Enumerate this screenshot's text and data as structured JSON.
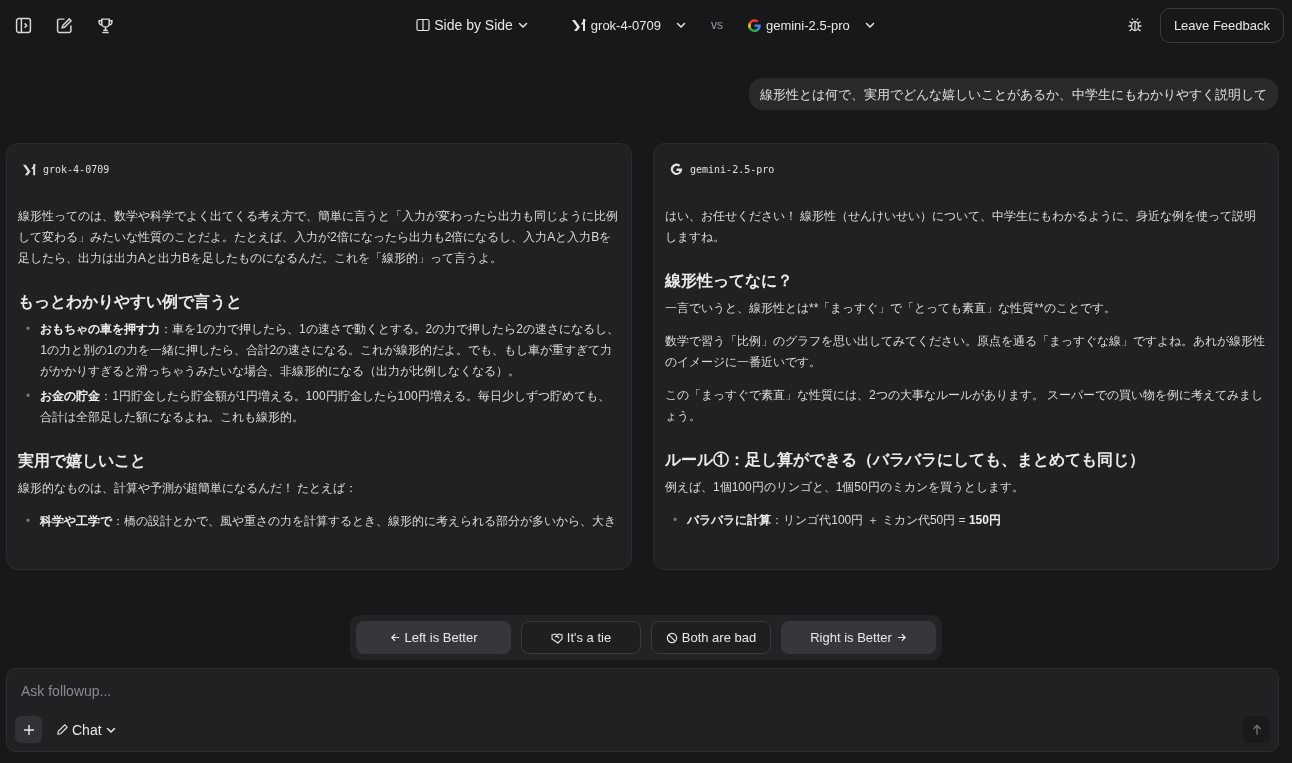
{
  "header": {
    "mode": "Side by Side",
    "model_a": "grok-4-0709",
    "vs": "vs",
    "model_b": "gemini-2.5-pro",
    "feedback": "Leave Feedback"
  },
  "prompt": "線形性とは何で、実用でどんな嬉しいことがあるか、中学生にもわかりやすく説明して",
  "panels": [
    {
      "model": "grok-4-0709",
      "blocks": [
        {
          "kind": "paragraph",
          "text": "線形性ってのは、数学や科学でよく出てくる考え方で、簡単に言うと「入力が変わったら出力も同じように比例して変わる」みたいな性質のことだよ。たとえば、入力が2倍になったら出力も2倍になるし、入力Aと入力Bを足したら、出力は出力Aと出力Bを足したものになるんだ。これを「線形的」って言うよ。"
        },
        {
          "kind": "heading",
          "text": "もっとわかりやすい例で言うと"
        },
        {
          "kind": "bullets",
          "items": [
            {
              "marker": "•",
              "text": "**おもちゃの車を押す力**：車を1の力で押したら、1の速さで動くとする。2の力で押したら2の速さになるし、1の力と別の1の力を一緒に押したら、合計2の速さになる。これが線形的だよ。でも、もし車が重すぎて力がかかりすぎると滑っちゃうみたいな場合、非線形的になる（出力が比例しなくなる）。"
            },
            {
              "marker": "•",
              "text": "**お金の貯金**：1円貯金したら貯金額が1円増える。100円貯金したら100円増える。毎日少しずつ貯めても、合計は全部足した額になるよね。これも線形的。"
            }
          ]
        },
        {
          "kind": "heading",
          "text": "実用で嬉しいこと"
        },
        {
          "kind": "paragraph",
          "text": "線形的なものは、計算や予測が超簡単になるんだ！ たとえば："
        },
        {
          "kind": "bullets",
          "items": [
            {
              "marker": "•",
              "text": "**科学や工学で**：橋の設計とかで、風や重さの力を計算するとき、線形的に考えられる部分が多いから、大き"
            }
          ]
        }
      ]
    },
    {
      "model": "gemini-2.5-pro",
      "blocks": [
        {
          "kind": "paragraph",
          "text": "はい、お任せください！ 線形性（せんけいせい）について、中学生にもわかるように、身近な例を使って説明しますね。"
        },
        {
          "kind": "heading",
          "text": "線形性ってなに？"
        },
        {
          "kind": "paragraph",
          "text": "一言でいうと、線形性とは**「まっすぐ」で「とっても素直」な性質**のことです。"
        },
        {
          "kind": "paragraph",
          "text": "数学で習う「比例」のグラフを思い出してみてください。原点を通る「まっすぐな線」ですよね。あれが線形性のイメージに一番近いです。"
        },
        {
          "kind": "paragraph",
          "text": "この「まっすぐで素直」な性質には、2つの大事なルールがあります。 スーパーでの買い物を例に考えてみましょう。"
        },
        {
          "kind": "heading",
          "text": "ルール①：足し算ができる（バラバラにしても、まとめても同じ）"
        },
        {
          "kind": "paragraph",
          "text": "例えば、1個100円のリンゴと、1個50円のミカンを買うとします。"
        },
        {
          "kind": "bullets",
          "items": [
            {
              "marker": "•",
              "text": "**バラバラに計算**：リンゴ代100円 ＋ ミカン代50円 = **150円**"
            }
          ]
        }
      ]
    }
  ],
  "votes": [
    {
      "label": "Left is Better",
      "kind": "left"
    },
    {
      "label": "It's a tie",
      "kind": "tie"
    },
    {
      "label": "Both are bad",
      "kind": "bad"
    },
    {
      "label": "Right is Better",
      "kind": "right"
    }
  ],
  "composer": {
    "placeholder": "Ask followup...",
    "mode": "Chat"
  }
}
